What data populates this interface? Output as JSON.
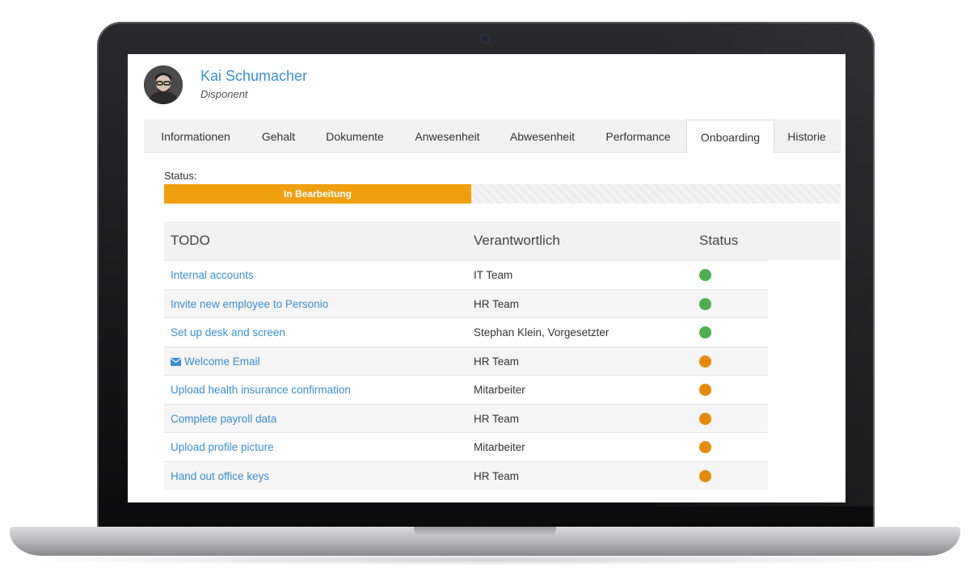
{
  "profile": {
    "name": "Kai Schumacher",
    "role": "Disponent"
  },
  "tabs": [
    {
      "label": "Informationen"
    },
    {
      "label": "Gehalt"
    },
    {
      "label": "Dokumente"
    },
    {
      "label": "Anwesenheit"
    },
    {
      "label": "Abwesenheit"
    },
    {
      "label": "Performance"
    },
    {
      "label": "Onboarding",
      "active": true
    },
    {
      "label": "Historie"
    }
  ],
  "status": {
    "label": "Status:",
    "value": "In Bearbeitung",
    "progress_fraction": 0.454,
    "color": "#f0a00f"
  },
  "table": {
    "headers": {
      "todo": "TODO",
      "responsible": "Verantwortlich",
      "status": "Status"
    },
    "rows": [
      {
        "todo": "Internal accounts",
        "responsible": "IT Team",
        "status": "done"
      },
      {
        "todo": "Invite new employee to Personio",
        "responsible": "HR Team",
        "status": "done"
      },
      {
        "todo": "Set up desk and screen",
        "responsible": "Stephan Klein, Vorgesetzter",
        "status": "done"
      },
      {
        "todo": "Welcome Email",
        "responsible": "HR Team",
        "status": "pending",
        "icon": "envelope-icon"
      },
      {
        "todo": "Upload health insurance confirmation",
        "responsible": "Mitarbeiter",
        "status": "pending"
      },
      {
        "todo": "Complete payroll data",
        "responsible": "HR Team",
        "status": "pending"
      },
      {
        "todo": "Upload profile picture",
        "responsible": "Mitarbeiter",
        "status": "pending"
      },
      {
        "todo": "Hand out office keys",
        "responsible": "HR Team",
        "status": "pending"
      }
    ]
  },
  "colors": {
    "link": "#3a8fd0",
    "done": "#4cae4f",
    "pending": "#e68a0c",
    "accent": "#f0a00f"
  }
}
